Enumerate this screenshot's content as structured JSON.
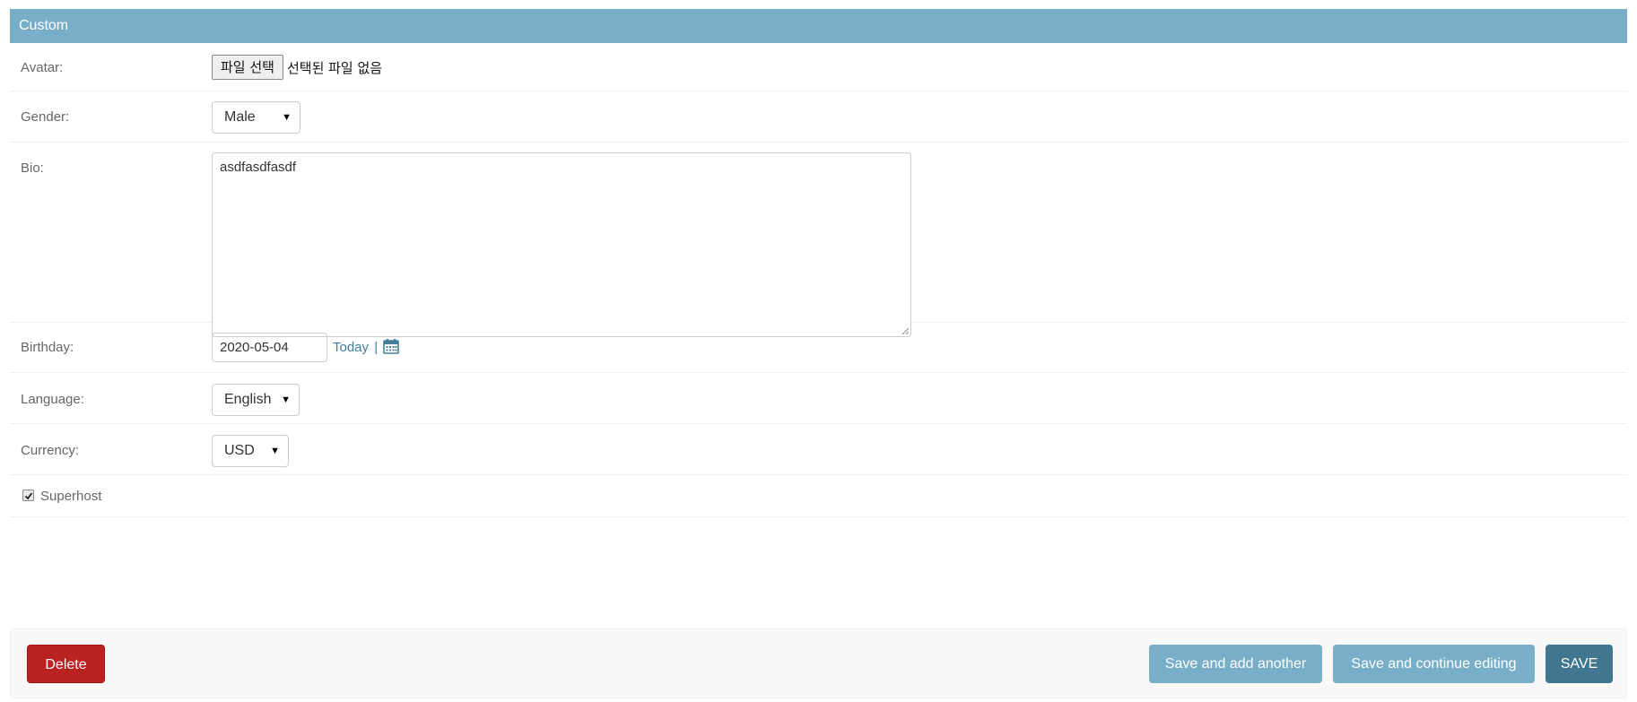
{
  "fieldset": {
    "title": "Custom"
  },
  "avatar": {
    "label": "Avatar:",
    "button_label": "파일 선택",
    "status": "선택된 파일 없음"
  },
  "gender": {
    "label": "Gender:",
    "selected": "Male"
  },
  "bio": {
    "label": "Bio:",
    "value": "asdfasdfasdf"
  },
  "birthday": {
    "label": "Birthday:",
    "value": "2020-05-04",
    "today_link": "Today",
    "separator": "|",
    "calendar_icon": "calendar-icon"
  },
  "language": {
    "label": "Language:",
    "selected": "English"
  },
  "currency": {
    "label": "Currency:",
    "selected": "USD"
  },
  "superhost": {
    "label": "Superhost",
    "checked": true
  },
  "actions": {
    "delete_label": "Delete",
    "save_add_label": "Save and add another",
    "save_continue_label": "Save and continue editing",
    "save_label": "SAVE"
  },
  "colors": {
    "header": "#79aec8",
    "link": "#447e9b",
    "delete": "#ba2121",
    "save": "#417690"
  }
}
